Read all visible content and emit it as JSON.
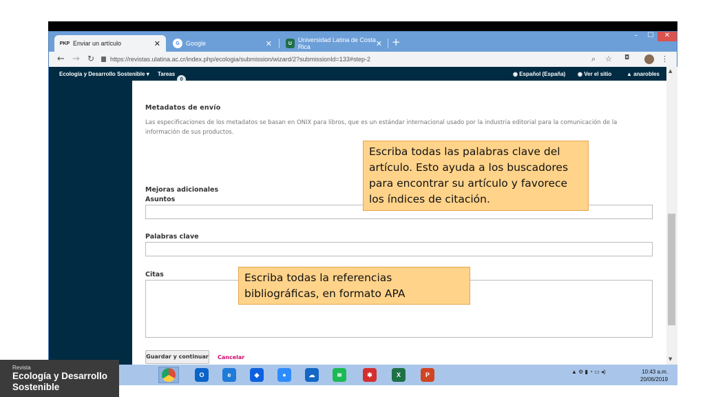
{
  "browser": {
    "tabs": [
      {
        "label": "Enviar un artículo",
        "favicon": "PKP"
      },
      {
        "label": "Google",
        "favicon": "G"
      },
      {
        "label": "Universidad Latina de Costa Rica",
        "favicon": "U"
      }
    ],
    "new_tab": "+",
    "url": "https://revistas.ulatina.ac.cr/index.php/ecologia/submission/wizard/2?submissionId=133#step-2",
    "window_controls": [
      "–",
      "☐",
      "✕"
    ]
  },
  "site": {
    "journal_menu": "Ecología y Desarrollo Sostenible",
    "tasks_label": "Tareas",
    "tasks_count": "0",
    "language": "Español (España)",
    "view_site": "Ver el sitio",
    "user": "anarobles"
  },
  "form": {
    "metadata_title": "Metadatos de envío",
    "metadata_desc": "Las especificaciones de los metadatos se basan en ONIX para libros, que es un estándar internacional usado por la industria editorial para la comunicación de la información de sus productos.",
    "additional_title": "Mejoras adicionales",
    "subjects_label": "Asuntos",
    "keywords_label": "Palabras clave",
    "citations_label": "Citas",
    "save_button": "Guardar y continuar",
    "cancel_link": "Cancelar"
  },
  "callouts": {
    "keywords": "Escriba todas las palabras clave del artículo. Esto ayuda a los buscadores para encontrar su artículo y favorece los índices de citación.",
    "references": "Escriba todas la referencias bibliográficas, en formato APA"
  },
  "taskbar": {
    "apps": [
      {
        "name": "chrome-icon",
        "glyph": "",
        "color": "#dd4b39"
      },
      {
        "name": "outlook-icon",
        "glyph": "O",
        "color": "#0a64c8"
      },
      {
        "name": "edge-icon",
        "glyph": "e",
        "color": "#1e7bd8"
      },
      {
        "name": "dropbox-icon",
        "glyph": "◆",
        "color": "#0d61e0"
      },
      {
        "name": "zoom-icon",
        "glyph": "●",
        "color": "#2d8cff"
      },
      {
        "name": "onedrive-icon",
        "glyph": "☁",
        "color": "#1467c5"
      },
      {
        "name": "spotify-icon",
        "glyph": "≋",
        "color": "#1db954"
      },
      {
        "name": "app-red-icon",
        "glyph": "✱",
        "color": "#d32f2f"
      },
      {
        "name": "excel-icon",
        "glyph": "X",
        "color": "#1e7145"
      },
      {
        "name": "powerpoint-icon",
        "glyph": "P",
        "color": "#d04423"
      }
    ],
    "time": "10:43 a.m.",
    "date": "20/06/2019"
  },
  "brand": {
    "small": "Revista",
    "title": "Ecología y Desarrollo Sostenible"
  }
}
